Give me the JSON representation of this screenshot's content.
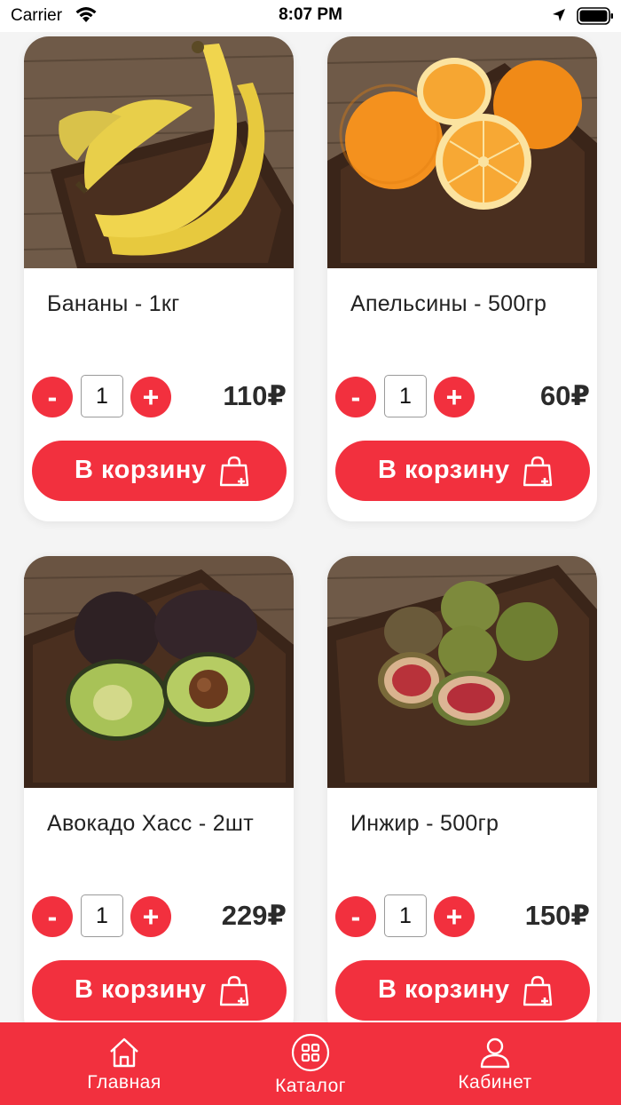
{
  "status_bar": {
    "carrier": "Carrier",
    "time": "8:07 PM"
  },
  "products": [
    {
      "title": "Бананы - 1кг",
      "quantity": "1",
      "price": "110₽",
      "cart_label": "В корзину",
      "image": "bananas"
    },
    {
      "title": "Апельсины - 500гр",
      "quantity": "1",
      "price": "60₽",
      "cart_label": "В корзину",
      "image": "oranges"
    },
    {
      "title": "Авокадо Хасс - 2шт",
      "quantity": "1",
      "price": "229₽",
      "cart_label": "В корзину",
      "image": "avocado"
    },
    {
      "title": "Инжир - 500гр",
      "quantity": "1",
      "price": "150₽",
      "cart_label": "В корзину",
      "image": "figs"
    }
  ],
  "stepper": {
    "minus": "-",
    "plus": "+"
  },
  "tab_bar": {
    "home": {
      "label": "Главная",
      "icon": "home-icon"
    },
    "catalog": {
      "label": "Каталог",
      "icon": "grid-icon"
    },
    "account": {
      "label": "Кабинет",
      "icon": "user-icon"
    }
  },
  "colors": {
    "accent": "#f2303e",
    "text": "#222222",
    "background": "#f4f4f4"
  }
}
